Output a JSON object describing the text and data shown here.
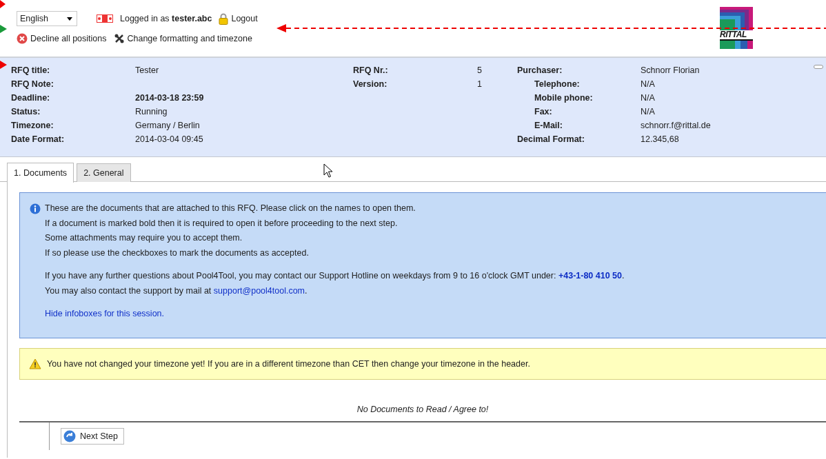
{
  "header": {
    "language": {
      "value": "English"
    },
    "login_text": "Logged in as",
    "username": "tester.abc",
    "logout": "Logout",
    "actions": [
      {
        "kind": "decline",
        "label": "Decline all positions"
      },
      {
        "kind": "settings",
        "label": "Change formatting and timezone"
      }
    ],
    "logo": {
      "text": "RITTAL"
    }
  },
  "details": {
    "groups": [
      {
        "fields": [
          {
            "label": "RFQ title:",
            "value": "Tester",
            "bold": false
          },
          {
            "label": "RFQ Note:"
          },
          {
            "label": "Deadline:",
            "value": "2014-03-18 23:59",
            "bold": true
          },
          {
            "label": "Status:",
            "value": "Running",
            "bold": false
          },
          {
            "label": "Timezone:",
            "value": "Germany / Berlin",
            "bold": false
          },
          {
            "label": "Date Format:",
            "value": "2014-03-04 09:45",
            "bold": false
          }
        ]
      },
      {
        "fields": [
          {
            "label": "RFQ Nr.:",
            "value": "5"
          },
          {
            "label": "Version:",
            "value": "1"
          }
        ]
      },
      {
        "fields": [
          {
            "label": "Purchaser:",
            "value": "Schnorr Florian",
            "indented": false
          },
          {
            "label": "Telephone:",
            "value": "N/A",
            "indented": true
          },
          {
            "label": "Mobile phone:",
            "value": "N/A",
            "indented": true
          },
          {
            "label": "Fax:",
            "value": "N/A",
            "indented": true
          },
          {
            "label": "E-Mail:",
            "value": "schnorr.f@rittal.de",
            "indented": true
          },
          {
            "label": "Decimal Format:",
            "value": "12.345,68",
            "indented": false
          }
        ]
      }
    ]
  },
  "tabs": [
    {
      "label": "1. Documents",
      "selected": true
    },
    {
      "label": "2. General",
      "selected": false
    }
  ],
  "infobox": {
    "paragraphs": [
      [
        {
          "text": "These are the documents that are attached to this RFQ. Please click on the names to open them."
        },
        {
          "text": "If a document is marked bold then it is required to open it before proceeding to the next step."
        },
        {
          "text": "Some attachments may require you to accept them."
        },
        {
          "text": "If so please use the checkboxes to mark the documents as accepted."
        }
      ],
      [
        {
          "text": "If you have any further questions about Pool4Tool, you may contact our Support Hotline on weekdays from 9 to 16 o'clock GMT under: **+43-1-80 410 50**."
        },
        {
          "text": "You may also contact the support by mail at",
          "link": "support@pool4tool.com",
          "after": "."
        }
      ],
      [
        {
          "link": "Hide infoboxes for this session."
        }
      ]
    ]
  },
  "warning": {
    "text": "You have not changed your timezone yet! If you are in a different timezone than CET then change your timezone in the header."
  },
  "empty_message": "No Documents to Read / Agree to!",
  "next_button": {
    "label": "Next Step"
  }
}
